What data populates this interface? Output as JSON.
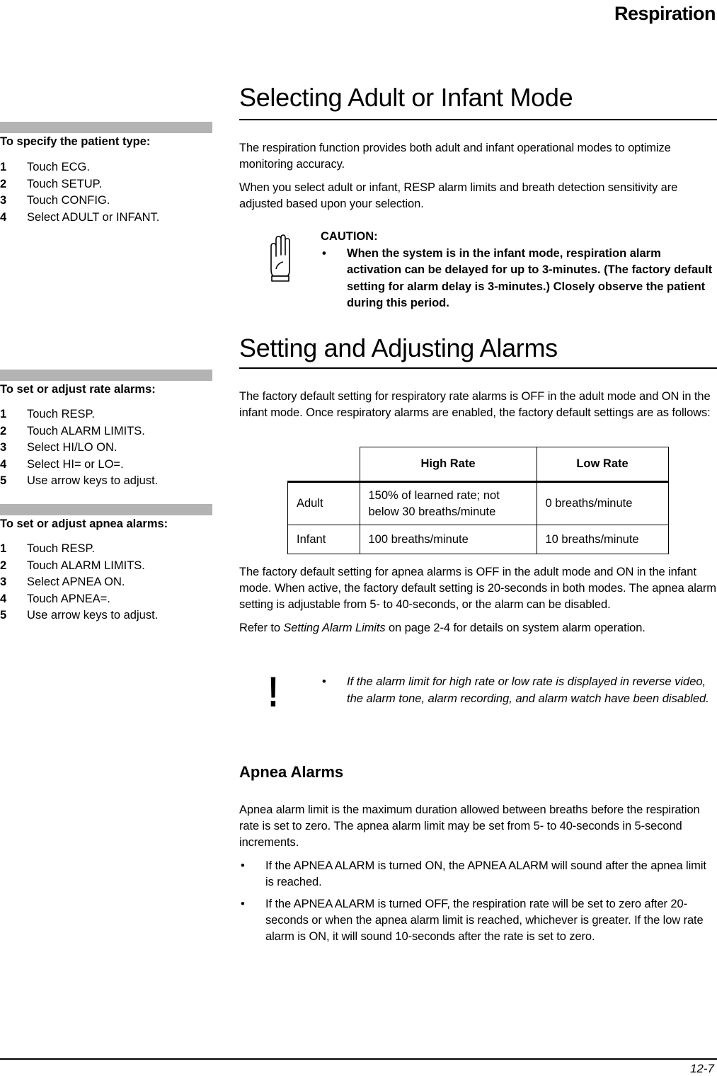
{
  "header": {
    "running_title": "Respiration"
  },
  "sidebar": {
    "procedures": [
      {
        "title": "To specify the patient type:",
        "steps": [
          {
            "num": "1",
            "text": "Touch ECG."
          },
          {
            "num": "2",
            "text": "Touch SETUP."
          },
          {
            "num": "3",
            "text": "Touch CONFIG."
          },
          {
            "num": "4",
            "text": "Select ADULT or INFANT."
          }
        ]
      },
      {
        "title": "To set or adjust rate alarms:",
        "steps": [
          {
            "num": "1",
            "text": "Touch RESP."
          },
          {
            "num": "2",
            "text": "Touch ALARM LIMITS."
          },
          {
            "num": "3",
            "text": "Select HI/LO ON."
          },
          {
            "num": "4",
            "text": "Select HI= or LO=."
          },
          {
            "num": "5",
            "text": "Use arrow keys to adjust."
          }
        ]
      },
      {
        "title": "To set or adjust apnea alarms:",
        "steps": [
          {
            "num": "1",
            "text": "Touch RESP."
          },
          {
            "num": "2",
            "text": "Touch ALARM LIMITS."
          },
          {
            "num": "3",
            "text": "Select APNEA ON."
          },
          {
            "num": "4",
            "text": "Touch APNEA=."
          },
          {
            "num": "5",
            "text": "Use arrow keys to adjust."
          }
        ]
      }
    ]
  },
  "section1": {
    "title": "Selecting Adult or Infant Mode",
    "paragraphs": [
      "The respiration function provides both adult and infant operational modes to optimize monitoring accuracy.",
      "When you select adult or infant, RESP alarm limits and breath detection sensitivity are adjusted based upon your selection."
    ],
    "caution": {
      "icon": "caution-hand-icon",
      "label": "CAUTION:",
      "bullet": "•",
      "text": "When the system is in the infant mode, respiration alarm activation can be delayed for up to 3-minutes. (The factory default setting for alarm delay is 3-minutes.) Closely observe the patient during this period."
    }
  },
  "section2": {
    "title": "Setting and Adjusting Alarms",
    "intro": "The factory default setting for respiratory rate alarms is OFF in the adult mode and ON in the infant mode. Once respiratory alarms are enabled, the factory default settings are as follows:",
    "table": {
      "headers": [
        "",
        "High Rate",
        "Low Rate"
      ],
      "rows": [
        [
          "Adult",
          "150% of learned rate; not below 30 breaths/minute",
          "0 breaths/minute"
        ],
        [
          "Infant",
          "100 breaths/minute",
          "10 breaths/minute"
        ]
      ]
    },
    "apnea_paragraph": "The factory default setting for apnea alarms is OFF in the adult mode and ON in the infant mode. When active, the factory default setting is 20-seconds in both modes. The apnea alarm setting is adjustable from 5- to 40-seconds, or the alarm can be disabled.",
    "refer": {
      "prefix": "Refer to ",
      "link_text": "Setting Alarm Limits",
      "suffix": " on page 2-4 for details on system alarm operation."
    },
    "note": {
      "icon": "exclamation-icon",
      "glyph": "!",
      "bullet": "•",
      "text": "If the alarm limit for high rate or low rate is displayed in reverse video, the alarm tone, alarm recording, and alarm watch have been disabled."
    }
  },
  "section3": {
    "title": "Apnea Alarms",
    "paragraph": "Apnea alarm limit is the maximum duration allowed between breaths before the respiration rate is set to zero. The apnea alarm limit may be set from 5- to 40-seconds in 5-second increments.",
    "bullets": [
      "If the APNEA ALARM is turned ON, the APNEA ALARM will sound after the apnea limit is reached.",
      "If the APNEA ALARM is turned OFF, the respiration rate will be set to zero after 20-seconds or when the apnea alarm limit is reached, whichever is greater. If the low rate alarm is ON, it will sound 10-seconds after the rate is set to zero."
    ],
    "bullet_glyph": "•"
  },
  "footer": {
    "page_number": "12-7"
  }
}
